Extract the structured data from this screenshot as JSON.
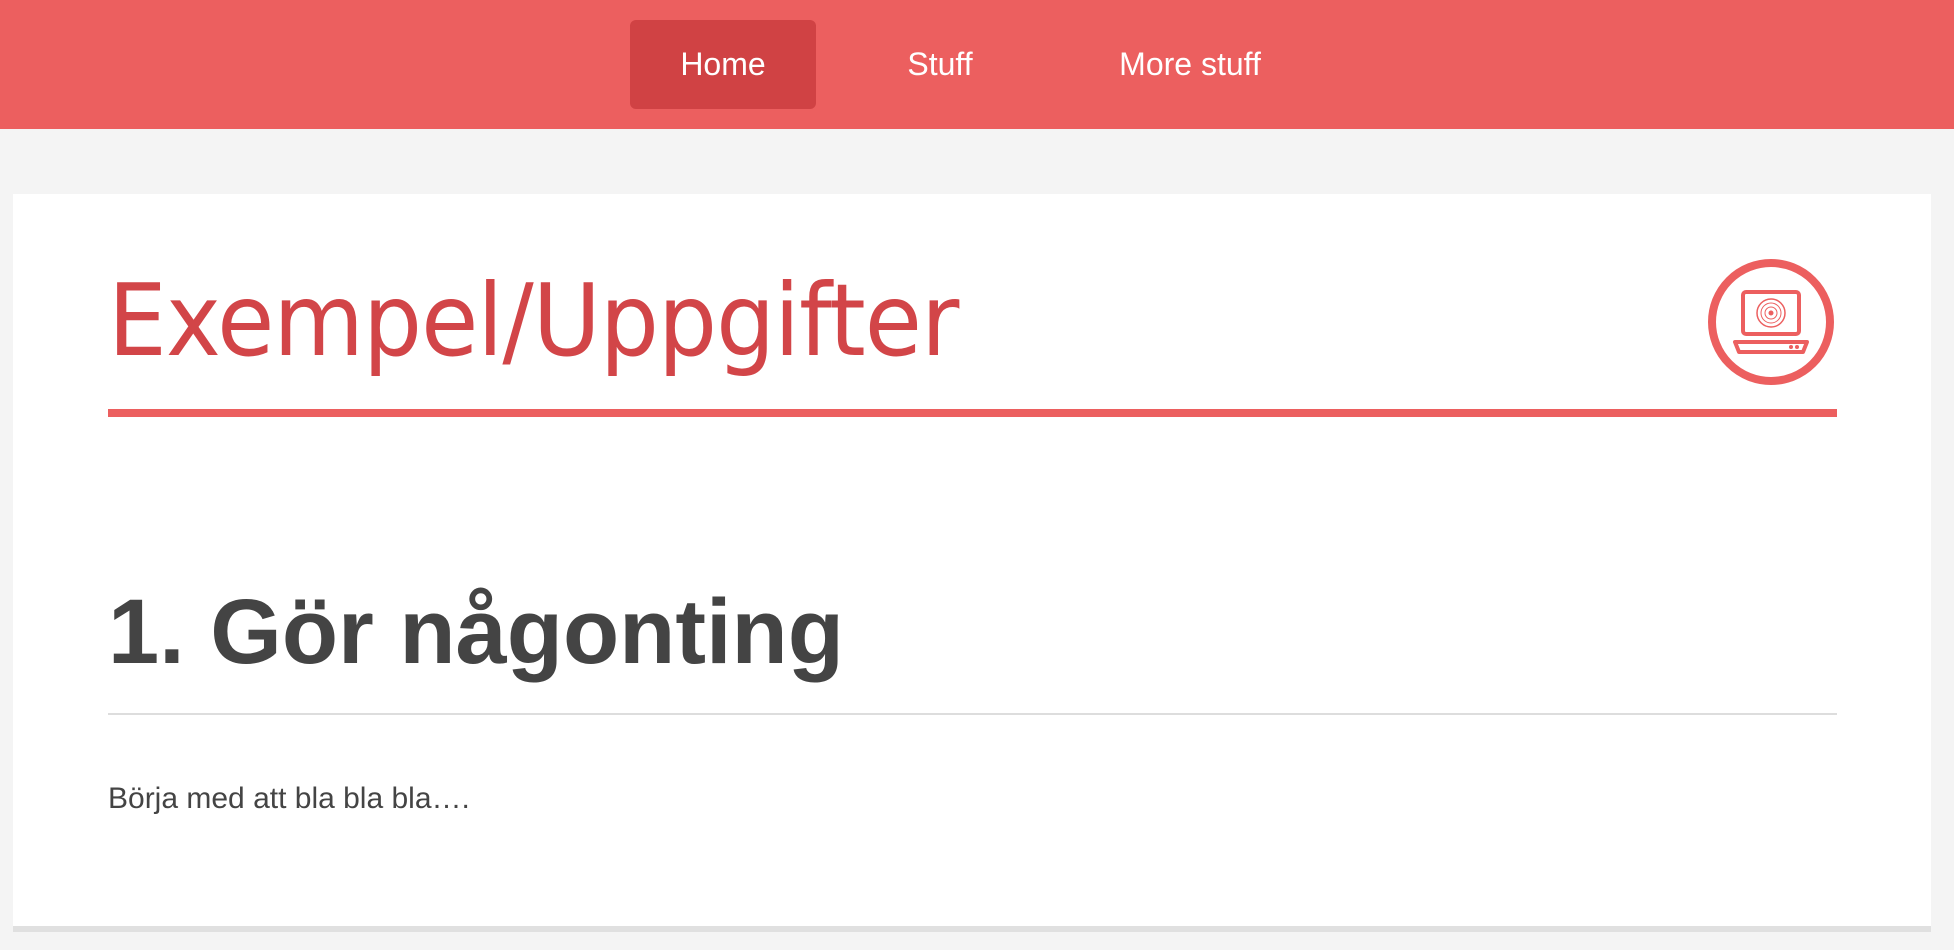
{
  "nav": {
    "items": [
      {
        "label": "Home",
        "active": true
      },
      {
        "label": "Stuff",
        "active": false
      },
      {
        "label": "More stuff",
        "active": false
      }
    ]
  },
  "page": {
    "title": "Exempel/Uppgifter",
    "logo_icon": "laptop-icon",
    "section_heading": "1. Gör någonting",
    "body_text": "Börja med att bla bla bla…."
  },
  "colors": {
    "nav_background": "#ec5f5f",
    "nav_active": "#d04244",
    "accent": "#d24548",
    "text": "#444444",
    "page_background": "#f4f4f4"
  }
}
